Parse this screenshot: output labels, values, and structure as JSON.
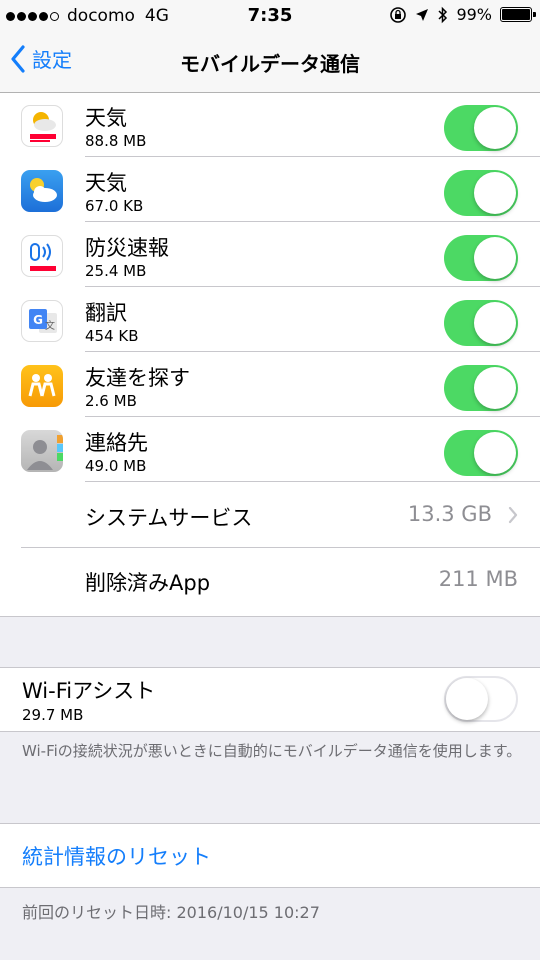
{
  "status_bar": {
    "carrier": "docomo",
    "network": "4G",
    "time": "7:35",
    "battery": "99%",
    "battery_level": 0.99
  },
  "nav": {
    "back_label": "設定",
    "title": "モバイルデータ通信"
  },
  "apps": [
    {
      "name": "天気",
      "size": "88.8 MB",
      "enabled": true,
      "icon": "yahoo-weather-icon"
    },
    {
      "name": "天気",
      "size": "67.0 KB",
      "enabled": true,
      "icon": "weather-icon"
    },
    {
      "name": "防災速報",
      "size": "25.4 MB",
      "enabled": true,
      "icon": "yahoo-disaster-alert-icon"
    },
    {
      "name": "翻訳",
      "size": "454 KB",
      "enabled": true,
      "icon": "google-translate-icon"
    },
    {
      "name": "友達を探す",
      "size": "2.6 MB",
      "enabled": true,
      "icon": "find-friends-icon"
    },
    {
      "name": "連絡先",
      "size": "49.0 MB",
      "enabled": true,
      "icon": "contacts-icon"
    }
  ],
  "system_services": {
    "label": "システムサービス",
    "value": "13.3 GB"
  },
  "deleted_apps": {
    "label": "削除済みApp",
    "value": "211 MB"
  },
  "wifi_assist": {
    "label": "Wi-Fiアシスト",
    "size": "29.7 MB",
    "enabled": false,
    "description": "Wi-Fiの接続状況が悪いときに自動的にモバイルデータ通信を使用します。"
  },
  "reset": {
    "label": "統計情報のリセット",
    "last_reset": "前回のリセット日時: 2016/10/15 10:27"
  },
  "colors": {
    "accent": "#147efb",
    "toggle_on": "#4cd964",
    "background": "#efeff4"
  }
}
